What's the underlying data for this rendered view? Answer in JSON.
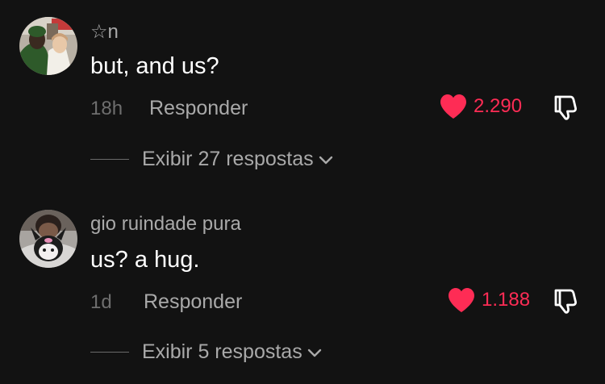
{
  "colors": {
    "background": "#121212",
    "like": "#fe2c55",
    "secondary_text": "#a9a9a9",
    "time_text": "#6e6e6e"
  },
  "comments": [
    {
      "username": "☆n",
      "text": "but, and us?",
      "time": "18h",
      "reply_label": "Responder",
      "likes": "2.290",
      "liked": true,
      "view_replies": "Exibir 27 respostas",
      "icons": [
        "heart-icon",
        "thumbs-down-icon",
        "chevron-down-icon"
      ]
    },
    {
      "username": "gio ruindade pura",
      "text": "us? a hug.",
      "time": "1d",
      "reply_label": "Responder",
      "likes": "1.188",
      "liked": true,
      "view_replies": "Exibir 5 respostas",
      "icons": [
        "heart-icon",
        "thumbs-down-icon",
        "chevron-down-icon"
      ]
    }
  ]
}
